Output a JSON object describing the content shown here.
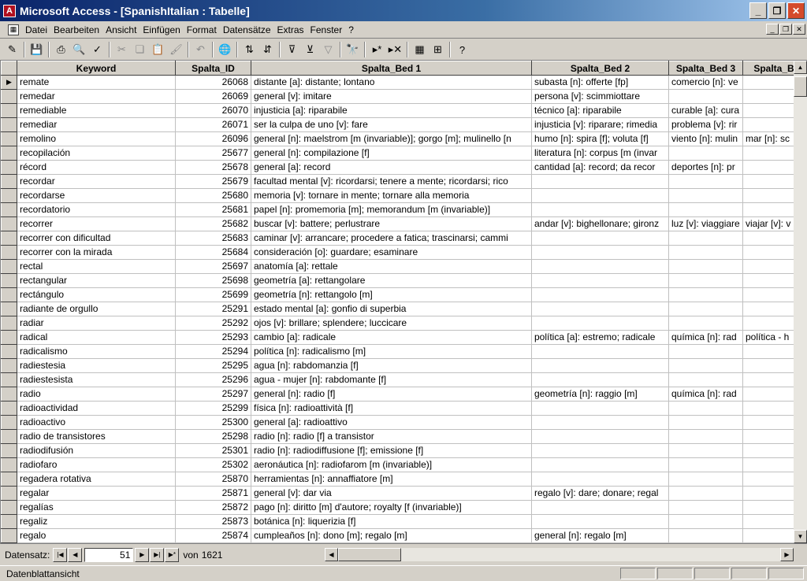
{
  "window": {
    "title": "Microsoft Access - [SpanishItalian : Tabelle]",
    "app_icon_letter": "A",
    "minimize_glyph": "_",
    "maximize_glyph": "❐",
    "close_glyph": "✕"
  },
  "menu": {
    "items": [
      "Datei",
      "Bearbeiten",
      "Ansicht",
      "Einfügen",
      "Format",
      "Datensätze",
      "Extras",
      "Fenster",
      "?"
    ]
  },
  "toolbar": {
    "icons": [
      {
        "name": "view-icon",
        "glyph": "✎"
      },
      {
        "name": "save-icon",
        "glyph": "💾"
      },
      {
        "name": "print-icon",
        "glyph": "⎙"
      },
      {
        "name": "print-preview-icon",
        "glyph": "🔍"
      },
      {
        "name": "spelling-icon",
        "glyph": "✓"
      },
      {
        "name": "cut-icon",
        "glyph": "✂"
      },
      {
        "name": "copy-icon",
        "glyph": "❏"
      },
      {
        "name": "paste-icon",
        "glyph": "📋"
      },
      {
        "name": "format-painter-icon",
        "glyph": "🖌"
      },
      {
        "name": "undo-icon",
        "glyph": "↶"
      },
      {
        "name": "insert-hyperlink-icon",
        "glyph": "🌐"
      },
      {
        "name": "sort-ascending-icon",
        "glyph": "⇅"
      },
      {
        "name": "sort-descending-icon",
        "glyph": "⇵"
      },
      {
        "name": "filter-by-selection-icon",
        "glyph": "⊽"
      },
      {
        "name": "filter-by-form-icon",
        "glyph": "⊻"
      },
      {
        "name": "apply-filter-icon",
        "glyph": "▽"
      },
      {
        "name": "find-icon",
        "glyph": "🔭"
      },
      {
        "name": "new-record-icon",
        "glyph": "▸*"
      },
      {
        "name": "delete-record-icon",
        "glyph": "▸✕"
      },
      {
        "name": "database-window-icon",
        "glyph": "▦"
      },
      {
        "name": "new-object-icon",
        "glyph": "⊞"
      },
      {
        "name": "help-icon",
        "glyph": "?"
      }
    ]
  },
  "grid": {
    "columns": [
      "Keyword",
      "Spalta_ID",
      "Spalta_Bed 1",
      "Spalta_Bed 2",
      "Spalta_Bed 3",
      "Spalta_B"
    ],
    "current_row_marker": "▶",
    "rows": [
      [
        "remate",
        "26068",
        "distante [a]: distante; lontano",
        "subasta [n]: offerte [fp]",
        "comercio [n]: ve",
        ""
      ],
      [
        "remedar",
        "26069",
        "general [v]: imitare",
        "persona [v]: scimmiottare",
        "",
        ""
      ],
      [
        "remediable",
        "26070",
        "injusticia [a]: riparabile",
        "técnico [a]: riparabile",
        "curable [a]: cura",
        ""
      ],
      [
        "remediar",
        "26071",
        "ser la culpa de uno [v]: fare",
        "injusticia [v]: riparare; rimedia",
        "problema [v]: rir",
        ""
      ],
      [
        "remolino",
        "26096",
        "general [n]: maelstrom [m (invariable)]; gorgo [m]; mulinello [n",
        "humo [n]: spira [f]; voluta [f]",
        "viento [n]: mulin",
        "mar [n]: sc"
      ],
      [
        "recopilación",
        "25677",
        "general [n]: compilazione [f]",
        "literatura [n]: corpus [m (invar",
        "",
        ""
      ],
      [
        "récord",
        "25678",
        "general [a]: record",
        "cantidad [a]: record; da recor",
        "deportes [n]: pr",
        ""
      ],
      [
        "recordar",
        "25679",
        "facultad mental [v]: ricordarsi; tenere a mente; ricordarsi; rico",
        "",
        "",
        ""
      ],
      [
        "recordarse",
        "25680",
        "memoria [v]: tornare in mente; tornare alla memoria",
        "",
        "",
        ""
      ],
      [
        "recordatorio",
        "25681",
        "papel [n]: promemoria [m]; memorandum [m (invariable)]",
        "",
        "",
        ""
      ],
      [
        "recorrer",
        "25682",
        "buscar [v]: battere; perlustrare",
        "andar [v]: bighellonare; gironz",
        "luz [v]: viaggiare",
        "viajar [v]: v"
      ],
      [
        "recorrer con dificultad",
        "25683",
        "caminar [v]: arrancare; procedere a fatica; trascinarsi; cammi",
        "",
        "",
        ""
      ],
      [
        "recorrer con la mirada",
        "25684",
        "consideración [o]: guardare; esaminare",
        "",
        "",
        ""
      ],
      [
        "rectal",
        "25697",
        "anatomía [a]: rettale",
        "",
        "",
        ""
      ],
      [
        "rectangular",
        "25698",
        "geometría [a]: rettangolare",
        "",
        "",
        ""
      ],
      [
        "rectángulo",
        "25699",
        "geometría [n]: rettangolo [m]",
        "",
        "",
        ""
      ],
      [
        "radiante de orgullo",
        "25291",
        "estado mental [a]: gonfio di superbia",
        "",
        "",
        ""
      ],
      [
        "radiar",
        "25292",
        "ojos [v]: brillare; splendere; luccicare",
        "",
        "",
        ""
      ],
      [
        "radical",
        "25293",
        "cambio [a]: radicale",
        "política [a]: estremo; radicale",
        "química [n]: rad",
        "política - h"
      ],
      [
        "radicalismo",
        "25294",
        "política [n]: radicalismo [m]",
        "",
        "",
        ""
      ],
      [
        "radiestesia",
        "25295",
        "agua [n]: rabdomanzia [f]",
        "",
        "",
        ""
      ],
      [
        "radiestesista",
        "25296",
        "agua - mujer [n]: rabdomante [f]",
        "",
        "",
        ""
      ],
      [
        "radio",
        "25297",
        "general [n]: radio [f]",
        "geometría [n]: raggio [m]",
        "química [n]: rad",
        ""
      ],
      [
        "radioactividad",
        "25299",
        "física [n]: radioattività [f]",
        "",
        "",
        ""
      ],
      [
        "radioactivo",
        "25300",
        "general [a]: radioattivo",
        "",
        "",
        ""
      ],
      [
        "radio de transistores",
        "25298",
        "radio [n]: radio [f] a transistor",
        "",
        "",
        ""
      ],
      [
        "radiodifusión",
        "25301",
        "radio [n]: radiodiffusione [f]; emissione [f]",
        "",
        "",
        ""
      ],
      [
        "radiofaro",
        "25302",
        "aeronáutica [n]: radiofarom [m (invariable)]",
        "",
        "",
        ""
      ],
      [
        "regadera rotativa",
        "25870",
        "herramientas [n]: annaffiatore [m]",
        "",
        "",
        ""
      ],
      [
        "regalar",
        "25871",
        "general [v]: dar via",
        "regalo [v]: dare; donare; regal",
        "",
        ""
      ],
      [
        "regalías",
        "25872",
        "pago [n]: diritto [m] d'autore; royalty [f (invariable)]",
        "",
        "",
        ""
      ],
      [
        "regaliz",
        "25873",
        "botánica [n]: liquerizia [f]",
        "",
        "",
        ""
      ],
      [
        "regalo",
        "25874",
        "cumpleaños [n]: dono [m]; regalo [m]",
        "general [n]: regalo [m]",
        "",
        ""
      ],
      [
        "regalo",
        "25875",
        "navidad [n]: dono [m]",
        "",
        "",
        ""
      ]
    ]
  },
  "navigation": {
    "label": "Datensatz:",
    "current": "51",
    "of_label": "von",
    "total": "1621",
    "first_glyph": "|◀",
    "prev_glyph": "◀",
    "next_glyph": "▶",
    "last_glyph": "▶|",
    "new_glyph": "▶*"
  },
  "scroll": {
    "up_glyph": "▲",
    "down_glyph": "▼",
    "left_glyph": "◀",
    "right_glyph": "▶"
  },
  "status": {
    "text": "Datenblattansicht"
  }
}
